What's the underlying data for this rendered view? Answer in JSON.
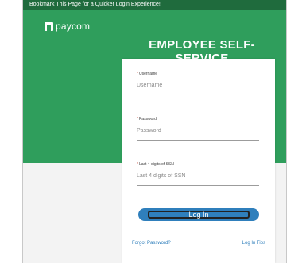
{
  "bookmark_bar": {
    "text": "Bookmark This Page for a Quicker Login Experience!"
  },
  "brand": {
    "name": "paycom"
  },
  "page": {
    "title": "EMPLOYEE SELF-SERVICE"
  },
  "form": {
    "username": {
      "required_mark": "*",
      "label": "Username",
      "placeholder": "Username",
      "value": ""
    },
    "password": {
      "required_mark": "*",
      "label": "Password",
      "placeholder": "Password",
      "value": ""
    },
    "ssn": {
      "required_mark": "*",
      "label": "Last 4 digits of SSN",
      "placeholder": "Last 4 digits of SSN",
      "value": ""
    },
    "login_label": "Log In",
    "forgot_password": "Forgot Password?",
    "login_tips": "Log In Tips"
  },
  "colors": {
    "brand_green": "#2f9e5c",
    "bookmark_bar": "#1f6b3d",
    "button_blue": "#2f7fbc"
  }
}
